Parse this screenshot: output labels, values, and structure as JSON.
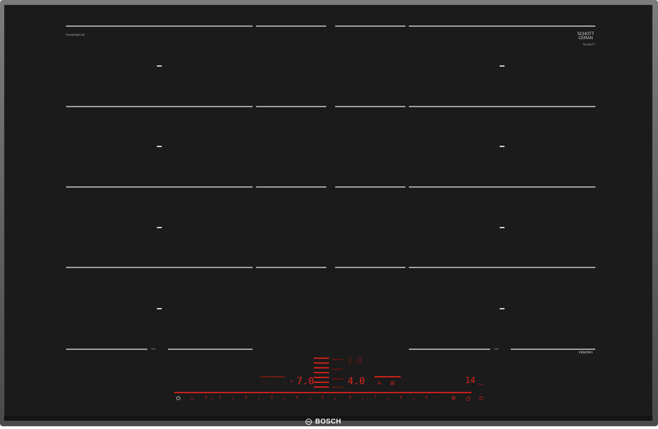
{
  "hob": {
    "model": "PXV875DC1E",
    "glass_maker_top": "SCHOTT",
    "glass_maker_bottom": "CERAN",
    "glass_small": "SCHOTT",
    "feature_label": "induction",
    "brand": "BOSCH"
  },
  "displays": {
    "top_middle": "3.0",
    "left_level": "7.0",
    "middle_level": "4.0",
    "timer": "14",
    "timer_unit": "min"
  },
  "scale": {
    "labels": [
      "0",
      "1",
      "2",
      "3",
      "4",
      "5",
      "6",
      "7",
      "8",
      "9"
    ]
  },
  "icons": {
    "power": "power-icon",
    "pan": "pan-icon",
    "timer": "timer-icon",
    "clock": "clock-icon",
    "lock": "lock-icon"
  },
  "colors": {
    "glass": "#1b1b1b",
    "frame": "#5a5a5a",
    "display_red": "#e0241c",
    "marking": "#b8b8b8"
  }
}
